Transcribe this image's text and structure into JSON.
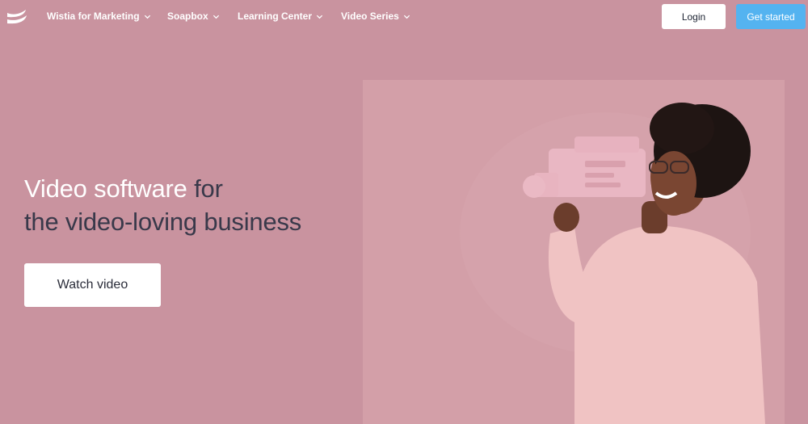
{
  "nav": {
    "logo_icon": "wistia-logo-icon",
    "items": [
      {
        "label": "Wistia for Marketing"
      },
      {
        "label": "Soapbox"
      },
      {
        "label": "Learning Center"
      },
      {
        "label": "Video Series"
      }
    ],
    "login_label": "Login",
    "get_started_label": "Get started"
  },
  "hero": {
    "title_highlight": "Video software",
    "title_rest": "for",
    "title_line2": "the video-loving business",
    "watch_label": "Watch video"
  },
  "colors": {
    "background": "#c9939f",
    "media_background": "#d39fa8",
    "cta_blue": "#54b3f0",
    "text_dark": "#39394a"
  }
}
